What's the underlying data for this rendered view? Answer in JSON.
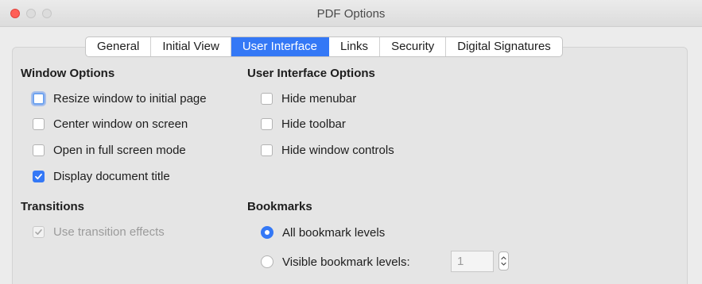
{
  "window": {
    "title": "PDF Options"
  },
  "tabs": [
    {
      "label": "General",
      "active": false
    },
    {
      "label": "Initial View",
      "active": false
    },
    {
      "label": "User Interface",
      "active": true
    },
    {
      "label": "Links",
      "active": false
    },
    {
      "label": "Security",
      "active": false
    },
    {
      "label": "Digital Signatures",
      "active": false
    }
  ],
  "window_options": {
    "heading": "Window Options",
    "items": [
      {
        "label": "Resize window to initial page",
        "checked": false,
        "focused": true
      },
      {
        "label": "Center window on screen",
        "checked": false
      },
      {
        "label": "Open in full screen mode",
        "checked": false
      },
      {
        "label": "Display document title",
        "checked": true
      }
    ]
  },
  "ui_options": {
    "heading": "User Interface Options",
    "items": [
      {
        "label": "Hide menubar",
        "checked": false
      },
      {
        "label": "Hide toolbar",
        "checked": false
      },
      {
        "label": "Hide window controls",
        "checked": false
      }
    ]
  },
  "transitions": {
    "heading": "Transitions",
    "use_transition_effects": {
      "label": "Use transition effects",
      "checked": true,
      "disabled": true
    }
  },
  "bookmarks": {
    "heading": "Bookmarks",
    "all_levels": {
      "label": "All bookmark levels",
      "selected": true
    },
    "visible_levels": {
      "label": "Visible bookmark levels:",
      "selected": false
    },
    "levels_value": "1"
  },
  "colors": {
    "accent": "#3478f6",
    "close_button": "#ff5f57",
    "background": "#ececec"
  }
}
